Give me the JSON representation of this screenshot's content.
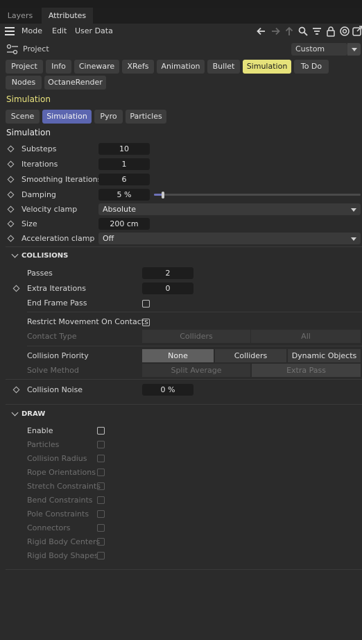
{
  "panel_tabs": [
    "Layers",
    "Attributes"
  ],
  "menu": [
    "Mode",
    "Edit",
    "User Data"
  ],
  "toolbar_icons": [
    "arrow-left-icon",
    "arrow-right-icon",
    "arrow-up-icon",
    "search-icon",
    "filter-icon",
    "lock-icon",
    "target-icon",
    "new-window-icon"
  ],
  "project": {
    "label": "Project",
    "preset": "Custom"
  },
  "main_tabs": [
    "Project",
    "Info",
    "Cineware",
    "XRefs",
    "Animation",
    "Bullet",
    "Simulation",
    "To Do",
    "Nodes",
    "OctaneRender"
  ],
  "active_main_tab": "Simulation",
  "section_title": "Simulation",
  "sub_tabs": [
    "Scene",
    "Simulation",
    "Pyro",
    "Particles"
  ],
  "active_sub_tab": "Simulation",
  "subsection_title": "Simulation",
  "params": {
    "substeps": {
      "label": "Substeps",
      "value": "10"
    },
    "iterations": {
      "label": "Iterations",
      "value": "1"
    },
    "smoothing": {
      "label": "Smoothing Iterations",
      "value": "6"
    },
    "damping": {
      "label": "Damping",
      "value": "5 %",
      "slider": 0.05
    },
    "velocity_clamp": {
      "label": "Velocity clamp",
      "value": "Absolute"
    },
    "size": {
      "label": "Size",
      "value": "200 cm"
    },
    "accel_clamp": {
      "label": "Acceleration clamp",
      "value": "Off"
    }
  },
  "collisions": {
    "title": "COLLISIONS",
    "passes": {
      "label": "Passes",
      "value": "2"
    },
    "extra_iterations": {
      "label": "Extra Iterations",
      "value": "0"
    },
    "end_frame_pass": {
      "label": "End Frame Pass",
      "checked": false
    },
    "restrict": {
      "label": "Restrict Movement On Contacts",
      "checked": false
    },
    "contact_type": {
      "label": "Contact Type",
      "options": [
        "Colliders",
        "All"
      ]
    },
    "priority": {
      "label": "Collision Priority",
      "options": [
        "None",
        "Colliders",
        "Dynamic Objects"
      ],
      "selected": "None"
    },
    "solve_method": {
      "label": "Solve Method",
      "options": [
        "Split Average",
        "Extra Pass"
      ],
      "selected": "Extra Pass"
    },
    "noise": {
      "label": "Collision Noise",
      "value": "0 %"
    }
  },
  "draw": {
    "title": "DRAW",
    "items": [
      {
        "label": "Enable",
        "enabled": true
      },
      {
        "label": "Particles",
        "enabled": false
      },
      {
        "label": "Collision Radius",
        "enabled": false
      },
      {
        "label": "Rope Orientations",
        "enabled": false
      },
      {
        "label": "Stretch Constraints",
        "enabled": false
      },
      {
        "label": "Bend Constraints",
        "enabled": false
      },
      {
        "label": "Pole Constraints",
        "enabled": false
      },
      {
        "label": "Connectors",
        "enabled": false
      },
      {
        "label": "Rigid Body Centers",
        "enabled": false
      },
      {
        "label": "Rigid Body Shapes",
        "enabled": false
      }
    ]
  },
  "colors": {
    "background": "#2b2b2b",
    "active_tab_yellow": "#e6e27a",
    "active_subtab_blue": "#5c66b0",
    "heading_yellow": "#e9e37d"
  }
}
